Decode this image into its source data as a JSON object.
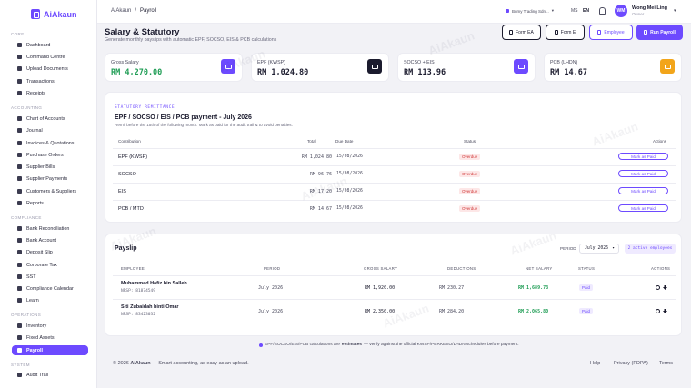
{
  "app": {
    "name": "AiAkaun",
    "brand_color": "#6d4aff"
  },
  "sidebar": {
    "groups": [
      {
        "label": "CORE",
        "items": [
          "Dashboard",
          "Command Centre",
          "Upload Documents",
          "Transactions",
          "Receipts"
        ]
      },
      {
        "label": "ACCOUNTING",
        "items": [
          "Chart of Accounts",
          "Journal",
          "Invoices & Quotations",
          "Purchase Orders",
          "Supplier Bills",
          "Supplier Payments",
          "Customers & Suppliers",
          "Reports"
        ]
      },
      {
        "label": "COMPLIANCE",
        "items": [
          "Bank Reconciliation",
          "Bank Account",
          "Deposit Slip",
          "Corporate Tax",
          "SST",
          "Compliance Calendar",
          "Learn"
        ]
      },
      {
        "label": "OPERATIONS",
        "items": [
          "Inventory",
          "Fixed Assets",
          "Payroll"
        ]
      },
      {
        "label": "SYSTEM",
        "items": [
          "Audit Trail"
        ]
      }
    ],
    "active": "Payroll"
  },
  "topbar": {
    "breadcrumb": [
      "AiAkaun",
      "Payroll"
    ],
    "breadcrumb_sep": "/",
    "company": "Bumy Trading Sdn...",
    "lang_ms": "MS",
    "lang_en": "EN",
    "user_initials": "WM",
    "user_name": "Wong Mei Ling",
    "user_role": "Owner"
  },
  "header": {
    "title": "Salary & Statutory",
    "subtitle": "Generate monthly payslips with automatic EPF, SOCSO, EIS & PCB calculations",
    "buttons": {
      "form_ea": "Form EA",
      "form_e": "Form E",
      "employee": "Employee",
      "run_payroll": "Run Payroll"
    }
  },
  "stats": [
    {
      "label": "Gross Salary",
      "value": "RM 4,270.00",
      "value_color": "#1f9d55",
      "icon": "wallet-icon",
      "icon_bg": "#6d4aff"
    },
    {
      "label": "EPF (KWSP)",
      "value": "RM 1,024.80",
      "value_color": "#1b1b2e",
      "icon": "bank-icon",
      "icon_bg": "#1b1b2e"
    },
    {
      "label": "SOCSO + EIS",
      "value": "RM 113.96",
      "value_color": "#1b1b2e",
      "icon": "shield-icon",
      "icon_bg": "#6d4aff"
    },
    {
      "label": "PCB (LHDN)",
      "value": "RM 14.67",
      "value_color": "#1b1b2e",
      "icon": "document-icon",
      "icon_bg": "#f2a51a"
    }
  ],
  "remittance": {
    "tag": "STATUTORY REMITTANCE",
    "title": "EPF / SOCSO / EIS / PCB payment - July 2026",
    "subtitle": "Remit before the 15th of the following month. Mark as paid for the audit trail & to avoid penalties.",
    "columns": [
      "Contribution",
      "Total",
      "Due Date",
      "Status",
      "Actions"
    ],
    "rows": [
      {
        "name": "EPF (KWSP)",
        "total": "RM 1,024.80",
        "due": "15/08/2026",
        "status": "Overdue",
        "action": "Mark as Paid"
      },
      {
        "name": "SOCSO",
        "total": "RM 96.76",
        "due": "15/08/2026",
        "status": "Overdue",
        "action": "Mark as Paid"
      },
      {
        "name": "EIS",
        "total": "RM 17.20",
        "due": "15/08/2026",
        "status": "Overdue",
        "action": "Mark as Paid"
      },
      {
        "name": "PCB / MTD",
        "total": "RM 14.67",
        "due": "15/08/2026",
        "status": "Overdue",
        "action": "Mark as Paid"
      }
    ]
  },
  "payslip": {
    "title": "Payslip",
    "period_label": "PERIOD",
    "period_value": "July 2026",
    "active_count": "2 active employees",
    "columns": [
      "EMPLOYEE",
      "PERIOD",
      "GROSS SALARY",
      "DEDUCTIONS",
      "NET SALARY",
      "STATUS",
      "ACTIONS"
    ],
    "rows": [
      {
        "name": "Muhammad Hafiz bin Salleh",
        "id": "NRSP: 81874549",
        "period": "July 2026",
        "gross": "RM 1,920.00",
        "deductions": "RM 230.27",
        "net": "RM 1,689.73",
        "status": "Paid"
      },
      {
        "name": "Siti Zubaidah binti Omar",
        "id": "NRSP: 83423032",
        "period": "July 2026",
        "gross": "RM 2,350.00",
        "deductions": "RM 284.20",
        "net": "RM 2,065.80",
        "status": "Paid"
      }
    ]
  },
  "note": {
    "prefix": "EPF/SOCSO/EIS/PCB calculations are ",
    "bold": "estimates",
    "suffix": " — verify against the official KWSP/PERKESO/LHDN schedules before payment."
  },
  "footer": {
    "copyright": "© 2026",
    "brand": "AiAkaun",
    "tagline": "— Smart accounting, as easy as an upload.",
    "links": [
      "Help",
      "Privacy (PDPA)",
      "Terms"
    ]
  },
  "watermark_text": "AiAkaun"
}
